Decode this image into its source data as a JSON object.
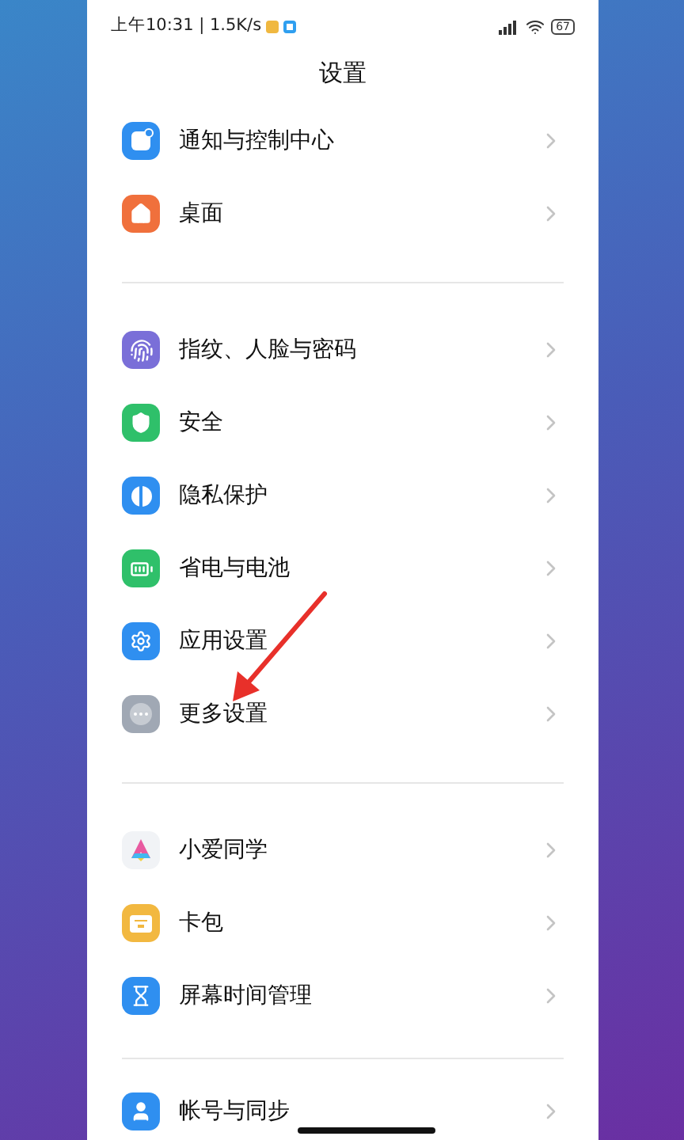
{
  "status_bar": {
    "time_speed": "上午10:31 | 1.5K/s",
    "battery": "67"
  },
  "title": "设置",
  "sections": [
    {
      "items": [
        {
          "label": "通知与控制中心"
        },
        {
          "label": "桌面"
        }
      ]
    },
    {
      "items": [
        {
          "label": "指纹、人脸与密码"
        },
        {
          "label": "安全"
        },
        {
          "label": "隐私保护"
        },
        {
          "label": "省电与电池"
        },
        {
          "label": "应用设置"
        },
        {
          "label": "更多设置"
        }
      ]
    },
    {
      "items": [
        {
          "label": "小爱同学"
        },
        {
          "label": "卡包"
        },
        {
          "label": "屏幕时间管理"
        }
      ]
    },
    {
      "items": [
        {
          "label": "帐号与同步"
        }
      ]
    }
  ]
}
